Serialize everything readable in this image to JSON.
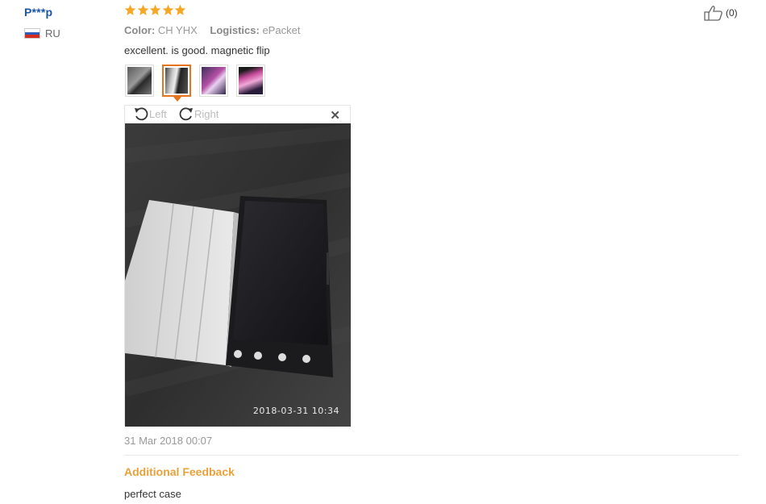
{
  "user": {
    "name": "P***p",
    "country": "RU"
  },
  "rating": {
    "stars": 5,
    "max": 5,
    "color": "#f5a623"
  },
  "helpful": {
    "count_label": "(0)",
    "icon": "thumbs-up-icon"
  },
  "meta": {
    "color_label": "Color:",
    "color_value": "CH YHX",
    "logistics_label": "Logistics:",
    "logistics_value": "ePacket"
  },
  "feedback": {
    "text": "excellent. is good. magnetic flip"
  },
  "images": {
    "count": 4,
    "selected_index": 1
  },
  "viewer": {
    "left_label": "Left",
    "right_label": "Right",
    "close_icon": "close-icon",
    "photo_timestamp": "2018-03-31  10:34"
  },
  "review_date": "31 Mar 2018 00:07",
  "additional": {
    "title": "Additional Feedback",
    "text": "perfect case"
  },
  "colors": {
    "user_link": "#1a56a8",
    "accent": "#e8741c",
    "additional_title": "#e8a13a"
  }
}
